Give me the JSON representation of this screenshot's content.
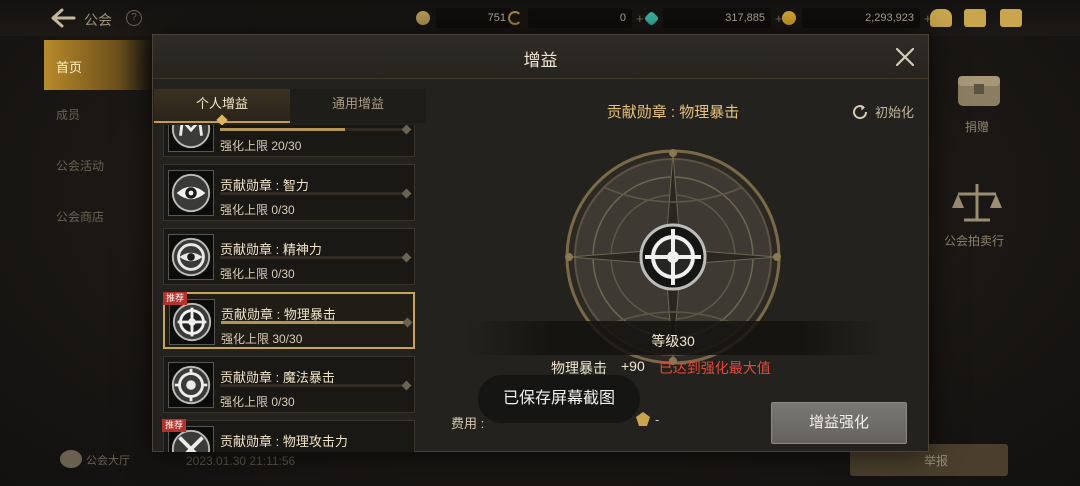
{
  "topbar": {
    "title": "公会",
    "currencies": [
      {
        "icon": "ore-icon",
        "value": "751",
        "color": "#b89b58"
      },
      {
        "icon": "moon-icon",
        "value": "0",
        "color": "#a88a45"
      },
      {
        "icon": "gem-icon",
        "value": "317,885",
        "color": "#3bb8a0"
      },
      {
        "icon": "gold-coin-icon",
        "value": "2,293,923",
        "color": "#d6a631"
      }
    ]
  },
  "left_nav": {
    "active": "首页",
    "items": [
      "成员",
      "公会活动",
      "公会商店"
    ],
    "lobby": "公会大厅"
  },
  "background": {
    "timestamp": "2023.01.30 21:11:56",
    "report_button": "举报",
    "donate_label": "捐赠",
    "auction_label": "公会拍卖行"
  },
  "modal": {
    "title": "增益",
    "tabs": [
      {
        "label": "个人增益",
        "active": true
      },
      {
        "label": "通用增益",
        "active": false
      }
    ],
    "items": [
      {
        "name": "",
        "cap": "强化上限 20/30",
        "fill": 0.667,
        "icon": "letter-m-medal-icon",
        "recommended": false,
        "selected": false
      },
      {
        "name": "贡献勋章 : 智力",
        "cap": "强化上限 0/30",
        "fill": 0,
        "icon": "eye-medal-icon",
        "recommended": false,
        "selected": false
      },
      {
        "name": "贡献勋章 : 精神力",
        "cap": "强化上限 0/30",
        "fill": 0,
        "icon": "swirl-eye-medal-icon",
        "recommended": false,
        "selected": false
      },
      {
        "name": "贡献勋章 : 物理暴击",
        "cap": "强化上限 30/30",
        "fill": 1,
        "icon": "crosshair-medal-icon",
        "recommended": true,
        "badge": "推荐",
        "selected": true
      },
      {
        "name": "贡献勋章 : 魔法暴击",
        "cap": "强化上限 0/30",
        "fill": 0,
        "icon": "magic-target-medal-icon",
        "recommended": false,
        "selected": false
      },
      {
        "name": "贡献勋章 : 物理攻击力",
        "cap": "",
        "fill": 0,
        "icon": "crossed-swords-medal-icon",
        "recommended": true,
        "badge": "推荐",
        "selected": false
      }
    ],
    "detail": {
      "title": "贡献勋章 : 物理暴击",
      "reset_label": "初始化",
      "level": "等级30",
      "stat_name": "物理暴击",
      "stat_value": "+90",
      "max_notice": "已达到强化最大值",
      "cost_label": "费用 :",
      "cost_value": "-",
      "boost_button": "增益强化"
    }
  },
  "toast": "已保存屏幕截图"
}
